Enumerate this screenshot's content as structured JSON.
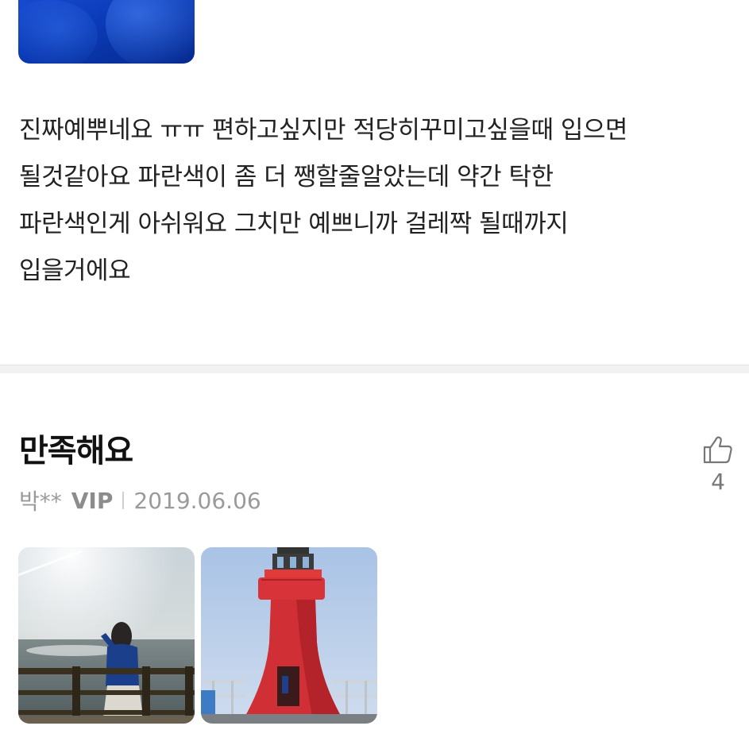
{
  "previous_review": {
    "body_lines": [
      "진짜예뿌네요 ㅠㅠ 편하고싶지만 적당히꾸미고싶을때 입으면",
      "될것같아요 파란색이 좀 더 쨍할줄알았는데 약간 탁한",
      "파란색인게 아쉬워요 그치만 예쁘니까 걸레짝 될때까지",
      "입을거에요"
    ],
    "photo_color": "#0b3bb8"
  },
  "review": {
    "title": "만족해요",
    "author": "박**",
    "grade": "VIP",
    "date": "2019.06.06",
    "like_icon": "thumbs-up-icon",
    "like_count": "4",
    "photos": [
      "sea-railing-photo",
      "red-lighthouse-photo"
    ]
  },
  "colors": {
    "separator": "#f1f1f1",
    "meta_text": "#9a9a9a",
    "title_text": "#111111"
  }
}
